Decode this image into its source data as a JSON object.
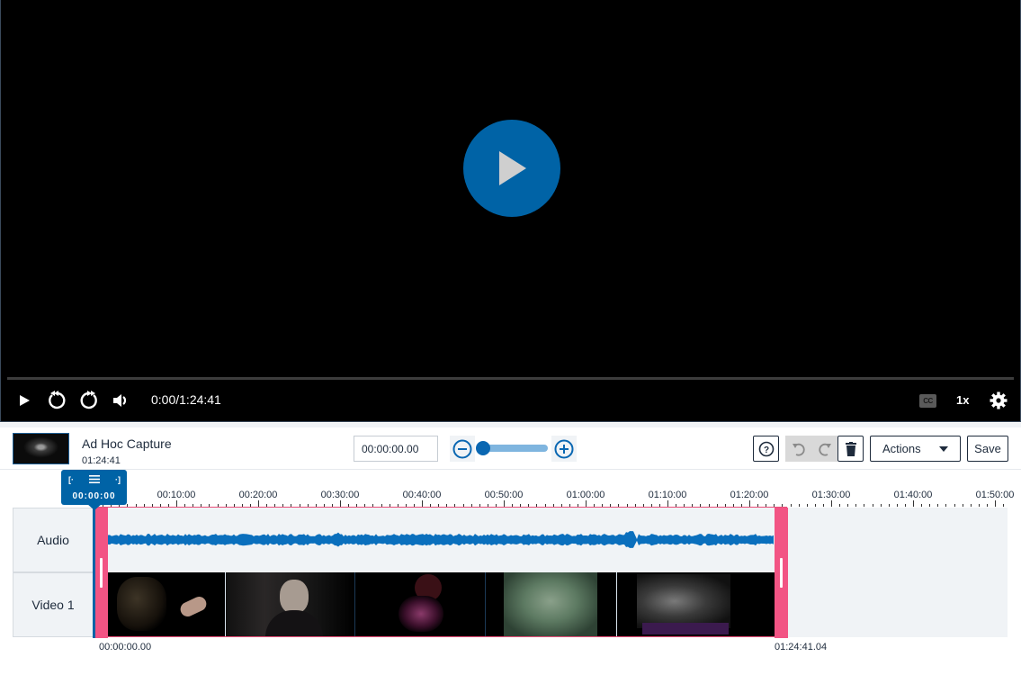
{
  "player": {
    "time_display": "0:00/1:24:41",
    "speed_label": "1x",
    "cc_label": "CC",
    "progress_fraction": 0,
    "icons": {
      "big_play": "play-icon",
      "play": "play-icon",
      "rewind": "rewind-icon",
      "forward": "forward-icon",
      "volume": "volume-icon",
      "captions": "closed-captions-icon",
      "settings": "gear-icon"
    }
  },
  "toolbar": {
    "media_title": "Ad Hoc Capture",
    "media_duration": "01:24:41",
    "timecode_value": "00:00:00.00",
    "zoom_level_fraction": 0,
    "actions_label": "Actions",
    "save_label": "Save",
    "help_label": "?"
  },
  "timeline": {
    "playhead_time": "00:00:00",
    "ruler_labels": [
      "00:00:00",
      "00:10:00",
      "00:20:00",
      "00:30:00",
      "00:40:00",
      "00:50:00",
      "01:00:00",
      "01:10:00",
      "01:20:00",
      "01:30:00",
      "01:40:00",
      "01:50:00"
    ],
    "tracks": [
      {
        "label": "Audio"
      },
      {
        "label": "Video 1"
      }
    ],
    "clip_start": "00:00:00.00",
    "clip_end": "01:24:41.04",
    "clip_duration_minutes": 84.68,
    "visible_range_minutes": 111,
    "colors": {
      "accent": "#0063a6",
      "selection": "#f25484",
      "waveform": "#0a6fbd"
    }
  }
}
